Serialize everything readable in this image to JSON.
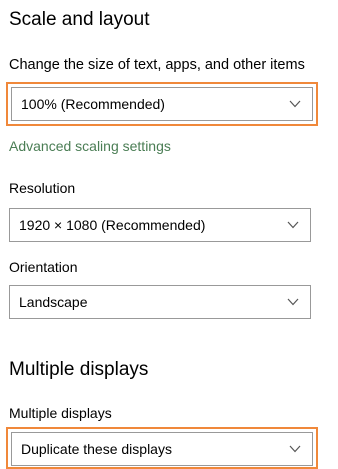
{
  "colors": {
    "highlight": "#f0883a",
    "link": "#4a7d54",
    "border": "#999999"
  },
  "scale_layout": {
    "heading": "Scale and layout",
    "size_label": "Change the size of text, apps, and other items",
    "size_value": "100% (Recommended)",
    "advanced_link": "Advanced scaling settings",
    "resolution_label": "Resolution",
    "resolution_value": "1920 × 1080 (Recommended)",
    "orientation_label": "Orientation",
    "orientation_value": "Landscape"
  },
  "multiple_displays": {
    "heading": "Multiple displays",
    "label": "Multiple displays",
    "value": "Duplicate these displays"
  },
  "icons": {
    "dropdown": "chevron-down-icon"
  }
}
